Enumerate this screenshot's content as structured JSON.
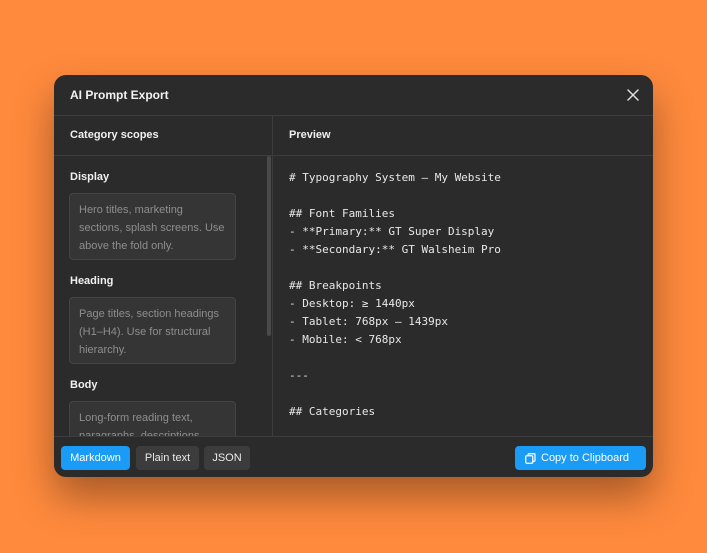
{
  "window": {
    "title": "AI Prompt Export",
    "close_icon": "close-icon"
  },
  "left": {
    "heading": "Category scopes",
    "scopes": [
      {
        "label": "Display",
        "placeholder": "Hero titles, marketing sections, splash screens. Use above the fold only."
      },
      {
        "label": "Heading",
        "placeholder": "Page titles, section headings (H1–H4). Use for structural hierarchy."
      },
      {
        "label": "Body",
        "placeholder": "Long-form reading text, paragraphs, descriptions."
      }
    ]
  },
  "right": {
    "heading": "Preview",
    "lines": [
      "# Typography System — My Website",
      "",
      "## Font Families",
      "- **Primary:** GT Super Display",
      "- **Secondary:** GT Walsheim Pro",
      "",
      "## Breakpoints",
      "- Desktop: ≥ 1440px",
      "- Tablet: 768px – 1439px",
      "- Mobile: < 768px",
      "",
      "---",
      "",
      "## Categories"
    ]
  },
  "footer": {
    "formats": [
      "Markdown",
      "Plain text",
      "JSON"
    ],
    "selected_format": "Markdown",
    "copy_label": "Copy to Clipboard",
    "copy_icon": "copy-icon"
  },
  "colors": {
    "background": "#ff8a3d",
    "accent": "#1a9bf5",
    "modal": "#2b2b2b"
  }
}
